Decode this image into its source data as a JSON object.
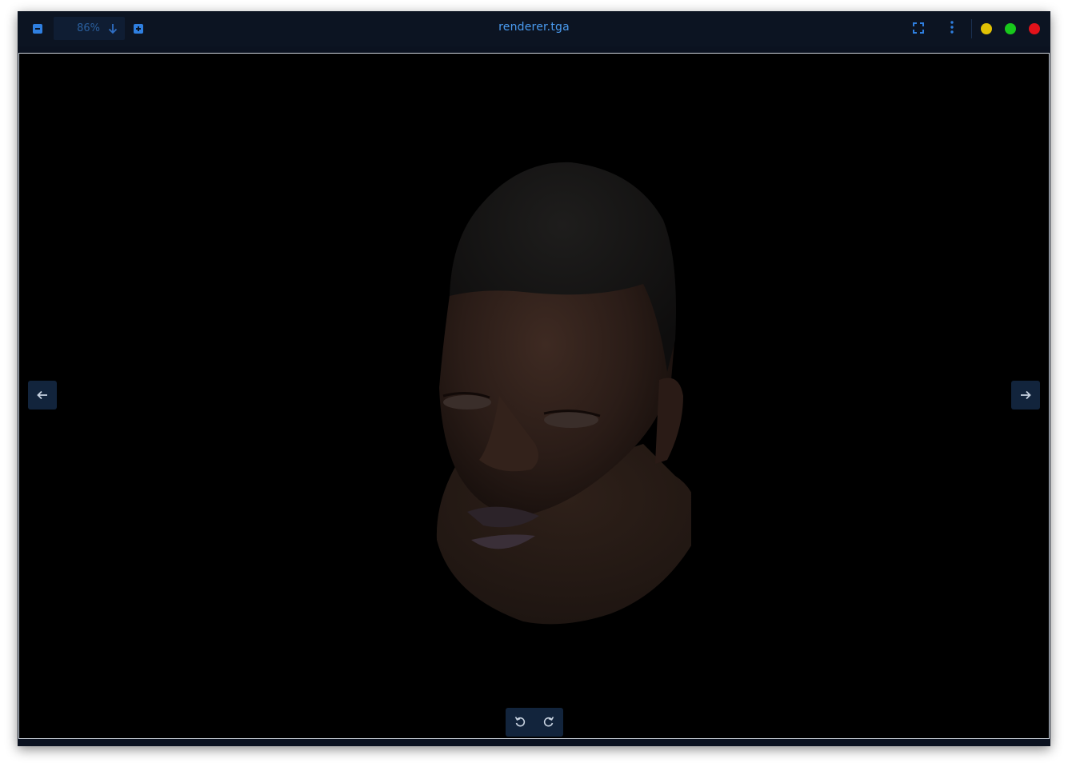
{
  "window": {
    "title": "renderer.tga"
  },
  "toolbar": {
    "zoom_value": "86%",
    "zoom_out_icon": "minus-square-icon",
    "zoom_in_icon": "plus-square-icon",
    "zoom_dropdown_icon": "arrow-down-icon",
    "fullscreen_icon": "fullscreen-icon",
    "menu_icon": "vertical-ellipsis-icon"
  },
  "window_controls": {
    "minimize_color": "#e2c204",
    "maximize_color": "#18c81c",
    "close_color": "#e3121a"
  },
  "viewer": {
    "prev_icon": "arrow-left-icon",
    "next_icon": "arrow-right-icon",
    "rotate_left_icon": "rotate-ccw-icon",
    "rotate_right_icon": "rotate-cw-icon",
    "image_subject": "3D rendered head model"
  },
  "colors": {
    "accent": "#2f7fe0",
    "title_text": "#4a9bf0",
    "background": "#000000",
    "toolbar_bg": "#0c1422"
  }
}
